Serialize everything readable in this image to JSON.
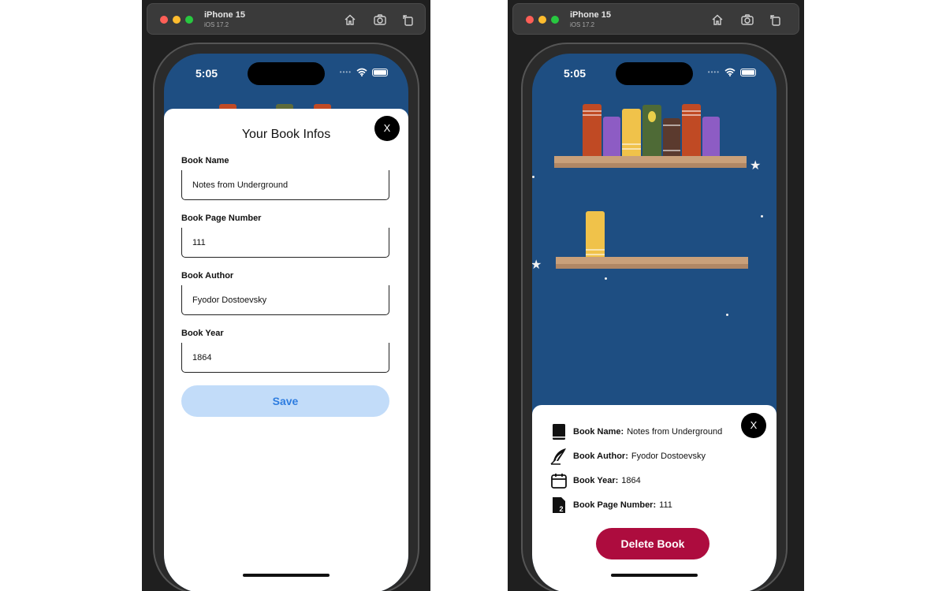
{
  "simulator": {
    "device_name": "iPhone 15",
    "os_version": "iOS 17.2",
    "toolbar_icons": [
      "home-icon",
      "screenshot-icon",
      "rotate-icon"
    ]
  },
  "status_bar": {
    "time": "5:05"
  },
  "edit_sheet": {
    "title": "Your Book Infos",
    "close_label": "X",
    "fields": [
      {
        "label": "Book Name",
        "value": "Notes from Underground"
      },
      {
        "label": "Book Page Number",
        "value": "111"
      },
      {
        "label": "Book Author",
        "value": "Fyodor Dostoevsky"
      },
      {
        "label": "Book Year",
        "value": "1864"
      }
    ],
    "save_label": "Save"
  },
  "detail_sheet": {
    "close_label": "X",
    "rows": [
      {
        "icon": "book-icon",
        "label": "Book Name:",
        "value": "Notes from Underground"
      },
      {
        "icon": "quill-icon",
        "label": "Book Author:",
        "value": "Fyodor Dostoevsky"
      },
      {
        "icon": "calendar-icon",
        "label": "Book Year:",
        "value": "1864"
      },
      {
        "icon": "page-number-icon",
        "label": "Book Page Number:",
        "value": "111"
      }
    ],
    "delete_label": "Delete Book"
  },
  "colors": {
    "background_blue": "#1e4e82",
    "save_button_bg": "#c2dcf9",
    "save_button_text": "#2e7de0",
    "delete_button_bg": "#ad0c3e",
    "shelf": "#c9a07a"
  }
}
